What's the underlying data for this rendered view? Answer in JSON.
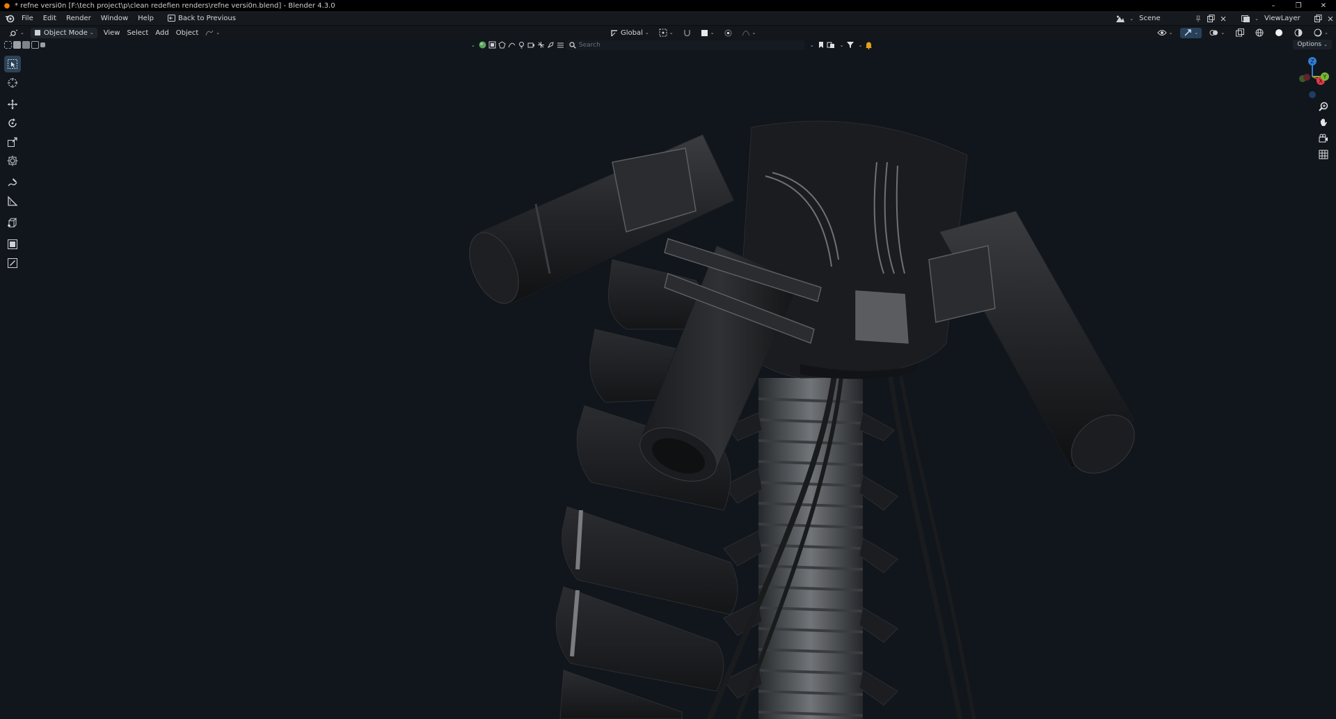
{
  "window": {
    "title": "* refne versi0n [F:\\tech project\\p\\clean redefien renders\\refne versi0n.blend] - Blender 4.3.0",
    "controls": [
      "–",
      "❐",
      "✕"
    ]
  },
  "menu": {
    "items": [
      "File",
      "Edit",
      "Render",
      "Window",
      "Help"
    ],
    "back_label": "Back to Previous",
    "scene_label": "Scene",
    "viewlayer_label": "ViewLayer"
  },
  "header": {
    "mode": "Object Mode",
    "menus": [
      "View",
      "Select",
      "Add",
      "Object"
    ],
    "transform_orientation": "Global"
  },
  "toolrow": {
    "search_placeholder": "Search",
    "options_label": "Options"
  },
  "gizmo": {
    "axis_z": "Z",
    "axis_x": "X",
    "axis_y": "Y"
  },
  "colors": {
    "background": "#11161c",
    "active_tool": "#2c4256",
    "axis_x": "#e03a4a",
    "axis_y": "#76b833",
    "axis_z": "#2f7fd8"
  },
  "icons": {
    "tools": [
      "select-box-icon",
      "cursor-icon",
      "move-icon",
      "rotate-icon",
      "scale-icon",
      "transform-icon",
      "annotate-icon",
      "measure-icon",
      "add-cube-icon",
      "spin-icon",
      "edit-icon"
    ]
  }
}
